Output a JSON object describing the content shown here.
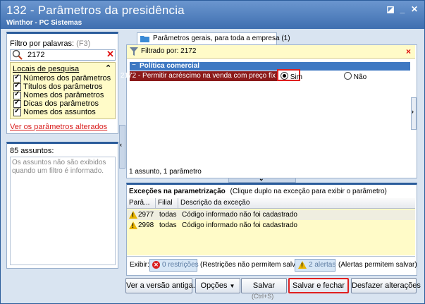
{
  "window": {
    "title": "132 - Parâmetros da presidência",
    "subtitle": "Winthor - PC Sistemas",
    "colors": {
      "title_bar": "#3f6fb0",
      "accent_red": "#d92020",
      "highlight_row": "#8b1a1a",
      "group_header": "#3e78c2"
    }
  },
  "filter": {
    "label": "Filtro por palavras:",
    "shortcut": "(F3)",
    "value": "2172"
  },
  "locations": {
    "title": "Locais de pesquisa",
    "items": [
      {
        "label": "Números dos parâmetros",
        "checked": true
      },
      {
        "label": "Títulos dos parâmetros",
        "checked": true
      },
      {
        "label": "Nomes dos parâmetros",
        "checked": true
      },
      {
        "label": "Dicas dos parâmetros",
        "checked": true
      },
      {
        "label": "Nomes dos assuntos",
        "checked": true
      }
    ],
    "changed_link": "Ver os parâmetros alterados"
  },
  "subjects": {
    "count_label": "85 assuntos:",
    "empty_message": "Os assuntos não são exibidos quando um filtro é informado."
  },
  "tab": {
    "label": "Parâmetros gerais, para toda a empresa",
    "count": "(1)"
  },
  "filtered": {
    "label": "Filtrado por: 2172"
  },
  "group": {
    "label": "Política comercial",
    "toggle": "−"
  },
  "param_row": {
    "label": "2172 - Permitir acréscimo na venda com preço fix",
    "option_yes": "Sim",
    "option_no": "Não",
    "selected": "Sim"
  },
  "summary": "1 assunto, 1 parâmetro",
  "exceptions": {
    "title": "Exceções na parametrização",
    "hint": "(Clique duplo na exceção para exibir o parâmetro)",
    "columns": [
      "Parâ...",
      "Filial",
      "Descrição da exceção"
    ],
    "rows": [
      {
        "param": "2977",
        "filial": "todas",
        "desc": "Código informado não foi cadastrado"
      },
      {
        "param": "2998",
        "filial": "todas",
        "desc": "Código informado não foi cadastrado"
      }
    ]
  },
  "show_bar": {
    "label": "Exibir:",
    "restrictions_count": "0 restrições",
    "restrictions_hint": "(Restrições não permitem salvar)",
    "alerts_count": "2 alertas",
    "alerts_hint": "(Alertas permitem salvar)"
  },
  "buttons": {
    "old_version": "Ver a versão antiga...",
    "options": "Opções",
    "save": "Salvar",
    "save_shortcut": "(Ctrl+S)",
    "save_close": "Salvar e fechar",
    "undo": "Desfazer alterações"
  }
}
